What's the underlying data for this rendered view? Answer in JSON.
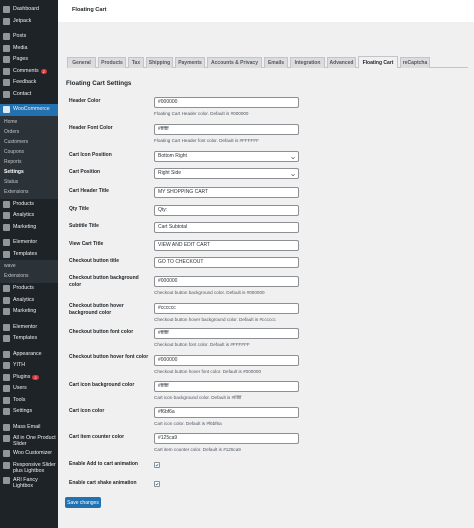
{
  "page_title": "Floating Cart",
  "sidebar": {
    "items_top": [
      {
        "label": "Dashboard",
        "icon": "dashboard-icon"
      },
      {
        "label": "Jetpack",
        "icon": "jetpack-icon"
      }
    ],
    "items_content": [
      {
        "label": "Posts",
        "icon": "pin-icon"
      },
      {
        "label": "Media",
        "icon": "media-icon"
      },
      {
        "label": "Pages",
        "icon": "pages-icon"
      },
      {
        "label": "Comments",
        "icon": "comments-icon",
        "badge": "2"
      },
      {
        "label": "Feedback",
        "icon": "feedback-icon"
      },
      {
        "label": "Contact",
        "icon": "contact-icon"
      }
    ],
    "woocommerce": {
      "label": "WooCommerce",
      "icon": "woocommerce-icon"
    },
    "woo_submenu": [
      "Home",
      "Orders",
      "Customers",
      "Coupons",
      "Reports",
      "Settings",
      "Status",
      "Extensions"
    ],
    "items_mid": [
      {
        "label": "Products",
        "icon": "products-icon"
      },
      {
        "label": "Analytics",
        "icon": "analytics-icon"
      },
      {
        "label": "Marketing",
        "icon": "marketing-icon"
      }
    ],
    "items_mid2": [
      {
        "label": "Elementor",
        "icon": "elementor-icon"
      },
      {
        "label": "Templates",
        "icon": "templates-icon"
      }
    ],
    "sub2": [
      "wave",
      "Extensions"
    ],
    "items_low": [
      {
        "label": "Products",
        "icon": "products-icon"
      },
      {
        "label": "Analytics",
        "icon": "analytics-icon"
      },
      {
        "label": "Marketing",
        "icon": "marketing-icon"
      }
    ],
    "items_low2": [
      {
        "label": "Elementor",
        "icon": "elementor-icon"
      },
      {
        "label": "Templates",
        "icon": "templates-icon"
      }
    ],
    "items_bottom": [
      {
        "label": "Appearance",
        "icon": "appearance-icon"
      },
      {
        "label": "YITH",
        "icon": "yith-icon"
      },
      {
        "label": "Plugins",
        "icon": "plugins-icon",
        "badge": "2"
      },
      {
        "label": "Users",
        "icon": "users-icon"
      },
      {
        "label": "Tools",
        "icon": "tools-icon"
      },
      {
        "label": "Settings",
        "icon": "settings-icon"
      }
    ],
    "items_plugins": [
      {
        "label": "Mass Email",
        "icon": "mail-icon"
      },
      {
        "label": "All in One Product Slider",
        "icon": "slider-icon"
      },
      {
        "label": "Woo Customizer",
        "icon": "customizer-icon"
      },
      {
        "label": "Responsive Slider plus Lightbox",
        "icon": "lightbox-icon"
      },
      {
        "label": "ARI Fancy Lightbox",
        "icon": "fancy-lightbox-icon"
      }
    ]
  },
  "tabs": [
    {
      "label": "General"
    },
    {
      "label": "Products"
    },
    {
      "label": "Tax"
    },
    {
      "label": "Shipping"
    },
    {
      "label": "Payments"
    },
    {
      "label": "Accounts & Privacy"
    },
    {
      "label": "Emails"
    },
    {
      "label": "Integration"
    },
    {
      "label": "Advanced"
    },
    {
      "label": "Floating Cart",
      "active": true
    },
    {
      "label": "reCaptcha"
    }
  ],
  "section_title": "Floating Cart Settings",
  "fields": {
    "header_color": {
      "label": "Header Color",
      "value": "#000000",
      "desc": "Floating Cart Header color. Default is #000000"
    },
    "header_font_color": {
      "label": "Header Font Color",
      "value": "#ffffff",
      "desc": "Floating Cart Header font color. Default is #FFFFFF"
    },
    "cart_icon_position": {
      "label": "Cart Icon Position",
      "value": "Bottom Right"
    },
    "cart_position": {
      "label": "Cart Position",
      "value": "Right Side"
    },
    "cart_header_title": {
      "label": "Cart Header Title",
      "value": "MY SHOPPING CART"
    },
    "qty_title": {
      "label": "Qty Title",
      "value": "Qty:"
    },
    "subtitle_title": {
      "label": "Subtitle Title",
      "value": "Cart Subtotal"
    },
    "view_cart_title": {
      "label": "View Cart Title",
      "value": "VIEW AND EDIT CART"
    },
    "checkout_button_title": {
      "label": "Checkout button title",
      "value": "GO TO CHECKOUT"
    },
    "checkout_button_bg": {
      "label": "Checkout button background color",
      "value": "#000000",
      "desc": "Checkout button background color. Default is #000000"
    },
    "checkout_button_hover_bg": {
      "label": "Checkout button hover background color",
      "value": "#cccccc",
      "desc": "Checkout button hover background color. Default is #cccccc"
    },
    "checkout_button_font": {
      "label": "Checkout button font color",
      "value": "#ffffff",
      "desc": "Checkout button font color. Default is #FFFFFF"
    },
    "checkout_button_hover_font": {
      "label": "Checkout button hover font color",
      "value": "#000000",
      "desc": "Checkout button hover font color. Default is #000000"
    },
    "cart_icon_bg": {
      "label": "Cart icon background color",
      "value": "#ffffff",
      "desc": "Cart icon background color. Default is #ffffff"
    },
    "cart_icon_color": {
      "label": "Cart icon color",
      "value": "#f6b f6a",
      "desc": "Cart icon color. Default is #f6bf6a"
    },
    "cart_item_counter": {
      "label": "Cart item counter color",
      "value": "#125ca9",
      "desc": "Cart item counter color. Default is #125ca9"
    },
    "enable_add_anim": {
      "label": "Enable Add to cart animation",
      "checked": true
    },
    "enable_shake_anim": {
      "label": "Enable cart shake animation",
      "checked": true
    }
  },
  "save_button": "Save changes",
  "colors": {
    "sidebar_bg": "#1d2327",
    "accent": "#2271b1",
    "page_bg": "#f0f0f1"
  }
}
